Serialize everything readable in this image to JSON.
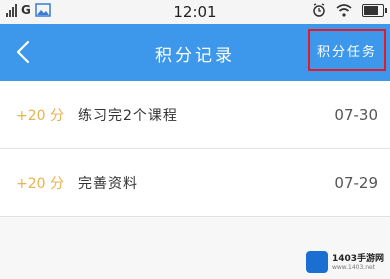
{
  "status_bar": {
    "carrier": "G",
    "time": "12:01"
  },
  "nav": {
    "title": "积分记录",
    "action_label": "积分任务"
  },
  "records": [
    {
      "points": "+20 分",
      "description": "练习完2个课程",
      "date": "07-30"
    },
    {
      "points": "+20 分",
      "description": "完善资料",
      "date": "07-29"
    }
  ],
  "watermark": {
    "text": "1403手游网",
    "sub": "www.1403.net"
  },
  "colors": {
    "nav_bg": "#3d97ea",
    "points": "#e8b24f",
    "highlight_border": "#e01b2a"
  }
}
